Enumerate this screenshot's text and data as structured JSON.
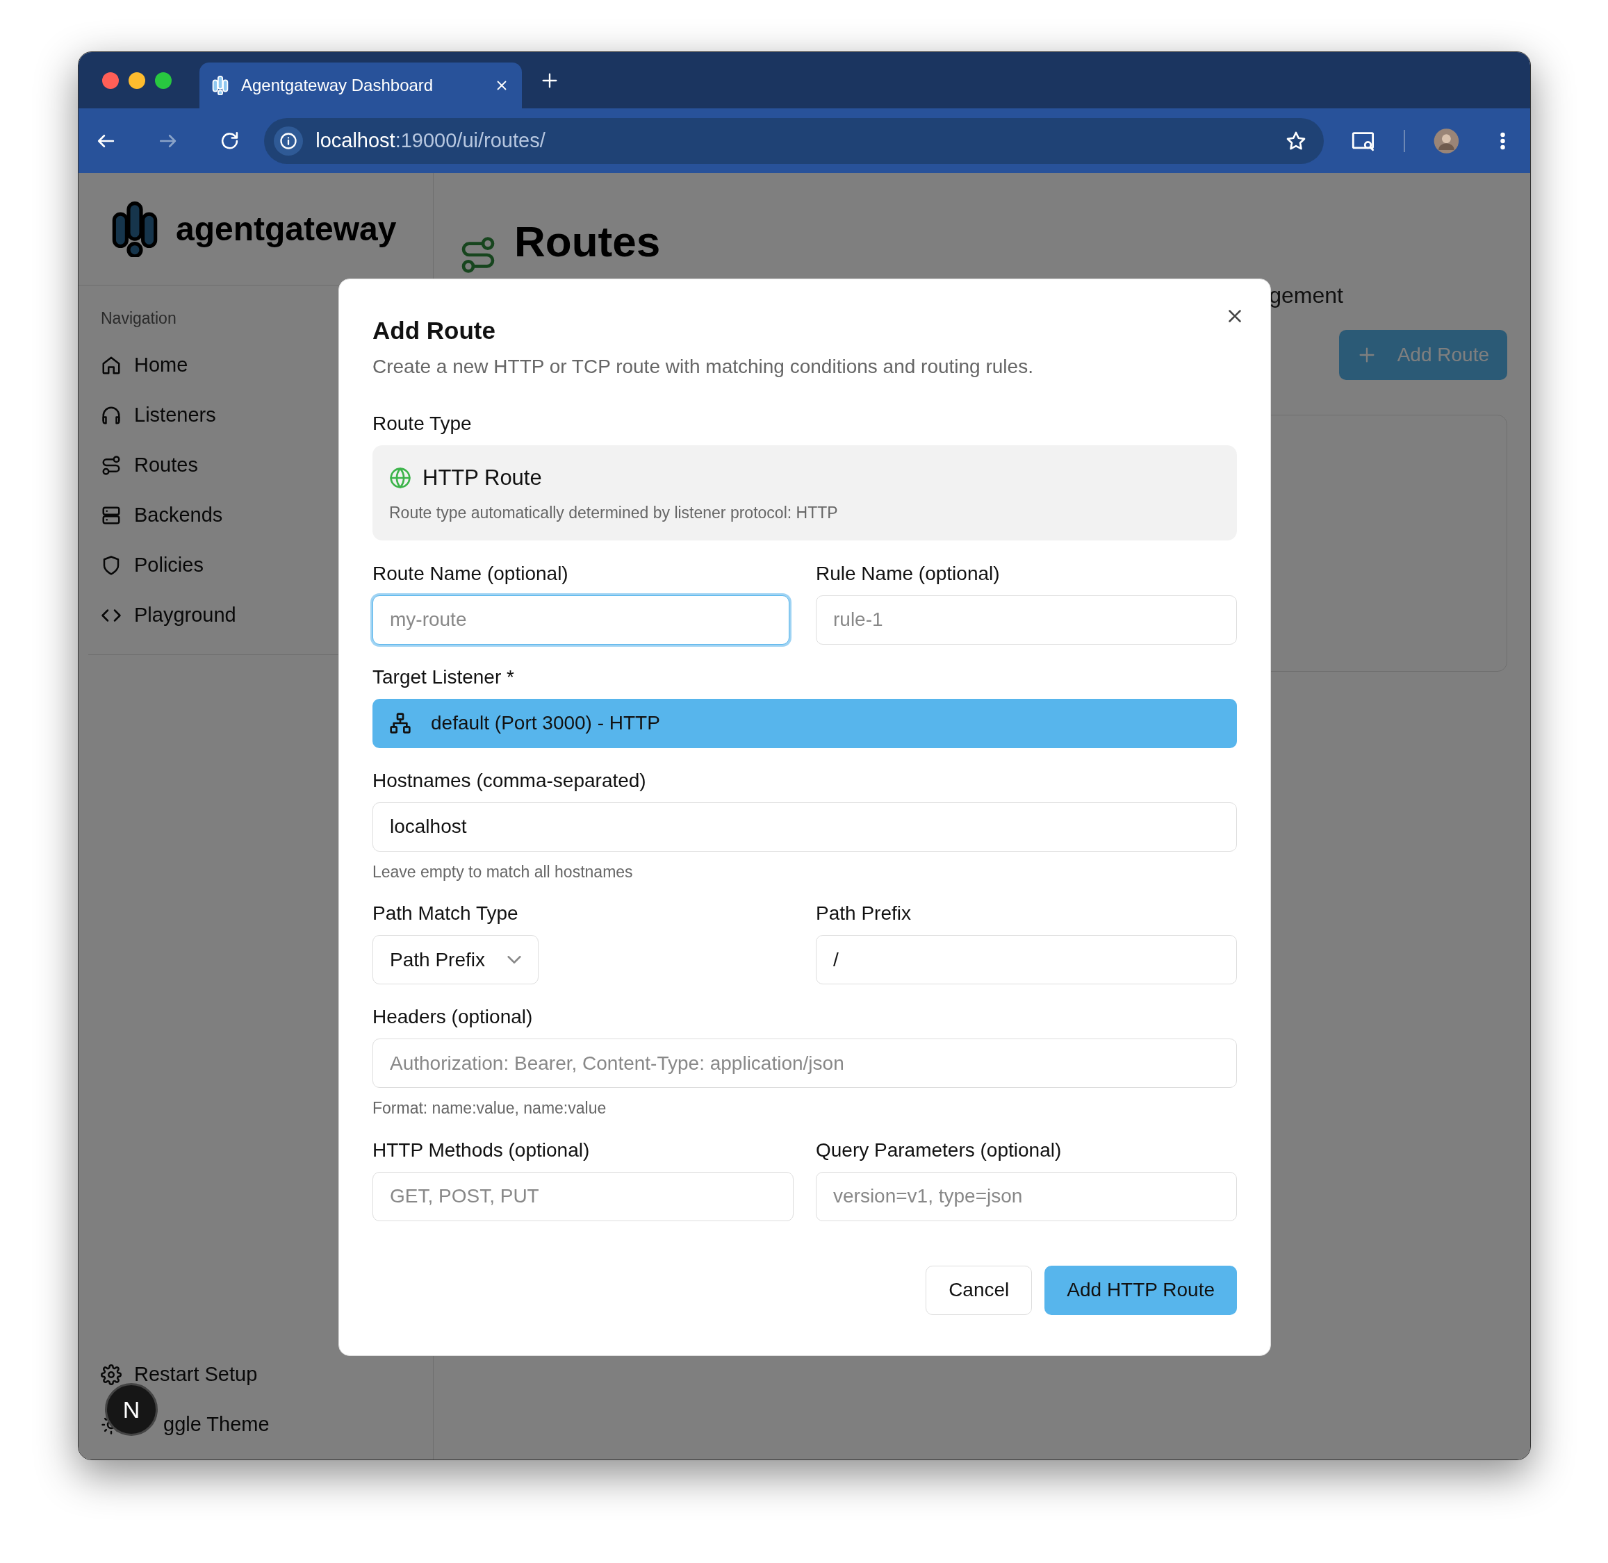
{
  "browser": {
    "tab_title": "Agentgateway Dashboard",
    "url_host": "localhost",
    "url_path": ":19000/ui/routes/"
  },
  "sidebar": {
    "brand": "agentgateway",
    "section": "Navigation",
    "items": [
      {
        "label": "Home"
      },
      {
        "label": "Listeners"
      },
      {
        "label": "Routes"
      },
      {
        "label": "Backends"
      },
      {
        "label": "Policies"
      },
      {
        "label": "Playground"
      }
    ],
    "footer": [
      {
        "label": "Restart Setup"
      },
      {
        "label": "ggle Theme"
      }
    ]
  },
  "page": {
    "title": "Routes",
    "subtitle": "gement",
    "add_button": "Add Route"
  },
  "dialog": {
    "title": "Add Route",
    "description": "Create a new HTTP or TCP route with matching conditions and routing rules.",
    "route_type": {
      "label": "Route Type",
      "name": "HTTP Route",
      "note": "Route type automatically determined by listener protocol: HTTP"
    },
    "route_name": {
      "label": "Route Name (optional)",
      "placeholder": "my-route",
      "focused": true
    },
    "rule_name": {
      "label": "Rule Name (optional)",
      "placeholder": "rule-1",
      "focused": false
    },
    "target_listener": {
      "label": "Target Listener *",
      "value": "default (Port 3000) - HTTP"
    },
    "hostnames": {
      "label": "Hostnames (comma-separated)",
      "value": "localhost",
      "hint": "Leave empty to match all hostnames"
    },
    "path_match_type": {
      "label": "Path Match Type",
      "value": "Path Prefix"
    },
    "path_prefix": {
      "label": "Path Prefix",
      "value": "/"
    },
    "headers": {
      "label": "Headers (optional)",
      "placeholder": "Authorization: Bearer, Content-Type: application/json",
      "hint": "Format: name:value, name:value"
    },
    "http_methods": {
      "label": "HTTP Methods (optional)",
      "placeholder": "GET, POST, PUT",
      "focused": false
    },
    "query_parameters": {
      "label": "Query Parameters (optional)",
      "placeholder": "version=v1, type=json",
      "focused": false
    },
    "cancel_button": "Cancel",
    "submit_button": "Add HTTP Route"
  },
  "dev_badge": "N"
}
